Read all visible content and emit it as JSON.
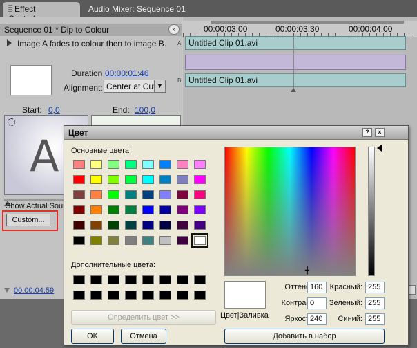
{
  "tabs": {
    "effect_controls": "Effect Controls",
    "close_glyph": "×",
    "audio_mixer": "Audio Mixer: Sequence 01"
  },
  "effect_controls": {
    "sequence_header": "Sequence 01 * Dip to Colour",
    "nav_glyph": "»",
    "description": "Image A fades to colour then to image B.",
    "duration_label": "Duration",
    "duration_value": "00:00:01:46",
    "alignment_label": "Alignment:",
    "alignment_value": "Center at Cut",
    "dropdown_glyph": "▼",
    "start_label": "Start:",
    "start_value": "0,0",
    "end_label": "End:",
    "end_value": "100,0",
    "thumb_letter": "A",
    "show_actual_sources": "Show Actual Sources",
    "custom_button": "Custom...",
    "bottom_timecode": "00:00:04:59"
  },
  "timeline": {
    "ruler_labels": [
      "00:00:03:00",
      "00:00:03:30",
      "00:00:04:00"
    ],
    "track_a_clip": "Untitled Clip 01.avi",
    "track_b_clip": "Untitled Clip 01.avi",
    "track_a_letter": "A",
    "track_b_letter": "B",
    "scroll_glyph": "▶"
  },
  "color_dialog": {
    "title": "Цвет",
    "help_glyph": "?",
    "close_glyph": "×",
    "basic_colors_label": "Основные цвета:",
    "basic_colors": [
      "#ff8080",
      "#ffff80",
      "#80ff80",
      "#00ff80",
      "#80ffff",
      "#0080ff",
      "#ff80c0",
      "#ff80ff",
      "#ff0000",
      "#ffff00",
      "#80ff00",
      "#00ff40",
      "#00ffff",
      "#0080c0",
      "#8080c0",
      "#ff00ff",
      "#804040",
      "#ff8040",
      "#00ff00",
      "#008080",
      "#004080",
      "#8080ff",
      "#800040",
      "#ff0080",
      "#800000",
      "#ff8000",
      "#008000",
      "#008040",
      "#0000ff",
      "#0000a0",
      "#800080",
      "#8000ff",
      "#400000",
      "#804000",
      "#004000",
      "#004040",
      "#000080",
      "#000040",
      "#400040",
      "#400080",
      "#000000",
      "#808000",
      "#808040",
      "#808080",
      "#408080",
      "#c0c0c0",
      "#400040",
      "#ffffff"
    ],
    "selected_index": 47,
    "custom_colors_label": "Дополнительные цвета:",
    "custom_colors": [
      "#000000",
      "#000000",
      "#000000",
      "#000000",
      "#000000",
      "#000000",
      "#000000",
      "#000000",
      "#000000",
      "#000000",
      "#000000",
      "#000000",
      "#000000",
      "#000000",
      "#000000",
      "#000000"
    ],
    "crosshair_glyph": "╋",
    "preview_caption": "Цвет|Заливка",
    "hue_label": "Оттенок:",
    "hue_value": "160",
    "sat_label": "Контраст:",
    "sat_value": "0",
    "lum_label": "Яркость:",
    "lum_value": "240",
    "red_label": "Красный:",
    "red_value": "255",
    "green_label": "Зеленый:",
    "green_value": "255",
    "blue_label": "Синий:",
    "blue_value": "255",
    "define_button": "Определить цвет >>",
    "ok_button": "OK",
    "cancel_button": "Отмена",
    "add_button": "Добавить в набор"
  }
}
